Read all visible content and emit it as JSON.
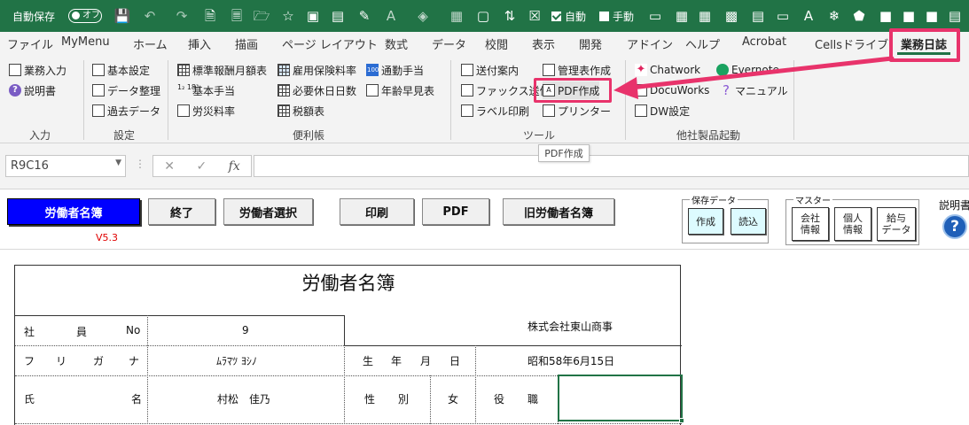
{
  "titlebar": {
    "autosave_label": "自動保存",
    "autosave_toggle": "オフ",
    "auto_label": "自動",
    "manual_label": "手動"
  },
  "tabs": [
    "ファイル",
    "MyMenu",
    "ホーム",
    "挿入",
    "描画",
    "ページ レイアウト",
    "数式",
    "データ",
    "校閲",
    "表示",
    "開発",
    "アドイン",
    "ヘルプ",
    "Acrobat",
    "Cellsドライブ",
    "業務日誌"
  ],
  "ribbon": {
    "input": {
      "items": [
        "業務入力",
        "説明書"
      ],
      "label": "入力"
    },
    "settings": {
      "items": [
        "基本設定",
        "データ整理",
        "過去データ"
      ],
      "label": "設定"
    },
    "convenience": {
      "col1": [
        "標準報酬月額表",
        "基本手当",
        "労災料率"
      ],
      "col2": [
        "雇用保険料率",
        "必要休日日数",
        "税額表"
      ],
      "col3": [
        "通勤手当",
        "年齢早見表"
      ],
      "label": "便利帳"
    },
    "tools": {
      "col1": [
        "送付案内",
        "ファックス送信",
        "ラベル印刷"
      ],
      "col2": [
        "管理表作成",
        "PDF作成",
        "プリンター"
      ],
      "label": "ツール"
    },
    "others": {
      "items": [
        "Chatwork",
        "Evernote",
        "DocuWorks",
        "マニュアル",
        "DW設定"
      ],
      "label": "他社製品起動"
    }
  },
  "tooltip": "PDF作成",
  "formula_bar": {
    "name_box": "R9C16",
    "fx": "fx"
  },
  "sheet": {
    "buttons": [
      "労働者名簿",
      "終了",
      "労働者選択",
      "印刷",
      "PDF",
      "旧労働者名簿"
    ],
    "version": "V5.3",
    "save_data": {
      "label": "保存データ",
      "create": "作成",
      "read": "読込"
    },
    "master": {
      "label": "マスター",
      "company": "会社\n情報",
      "personal": "個人\n情報",
      "salary": "給与\nデータ"
    },
    "help_label": "説明書",
    "help_symbol": "?"
  },
  "form": {
    "title": "労働者名簿",
    "company": "株式会社東山商事",
    "employee_no_label": [
      "社",
      "員",
      "No"
    ],
    "employee_no": "9",
    "furigana_label": [
      "フ",
      "リ",
      "ガ",
      "ナ"
    ],
    "furigana": "ﾑﾗﾏﾂ ﾖｼﾉ",
    "birth_label": [
      "生",
      "年",
      "月",
      "日"
    ],
    "birth_date": "昭和58年6月15日",
    "name_label": [
      "氏",
      "名"
    ],
    "name": "村松　佳乃",
    "gender_label": [
      "性",
      "別"
    ],
    "gender": "女",
    "position_label": [
      "役",
      "職"
    ]
  },
  "colors": {
    "excel_green": "#217346",
    "highlight": "#e8336b",
    "blue_button": "#0000ff",
    "version_red": "#e00000"
  }
}
